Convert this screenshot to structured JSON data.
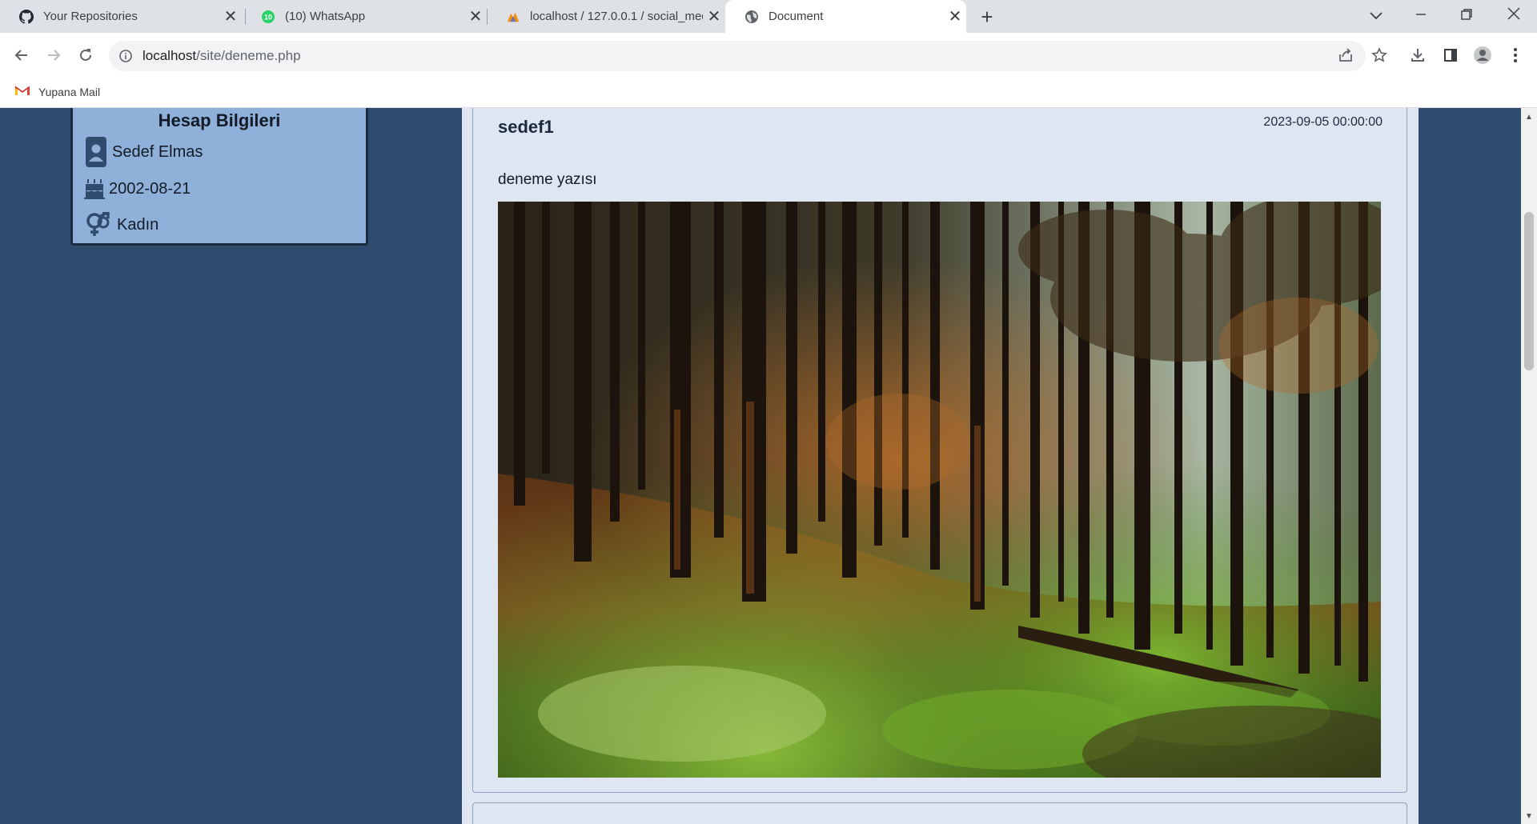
{
  "browser": {
    "tabs": [
      {
        "title": "Your Repositories",
        "icon": "github-icon"
      },
      {
        "title": "(10) WhatsApp",
        "icon": "whatsapp-icon",
        "badge": "10"
      },
      {
        "title": "localhost / 127.0.0.1 / social_med",
        "icon": "phpmyadmin-icon"
      },
      {
        "title": "Document",
        "icon": "globe-icon",
        "active": true
      }
    ],
    "url_host": "localhost",
    "url_path": "/site/deneme.php",
    "bookmarks": [
      {
        "label": "Yupana Mail",
        "icon": "gmail-icon"
      }
    ]
  },
  "account": {
    "title": "Hesap Bilgileri",
    "name": "Sedef Elmas",
    "birthdate": "2002-08-21",
    "gender": "Kadın"
  },
  "post": {
    "author": "sedef1",
    "date": "2023-09-05 00:00:00",
    "text": "deneme yazısı",
    "image": "forest-photo"
  },
  "colors": {
    "page_bg": "#2f4b6e",
    "card_bg": "#8fb0d9",
    "feed_bg": "#dde6f1"
  }
}
